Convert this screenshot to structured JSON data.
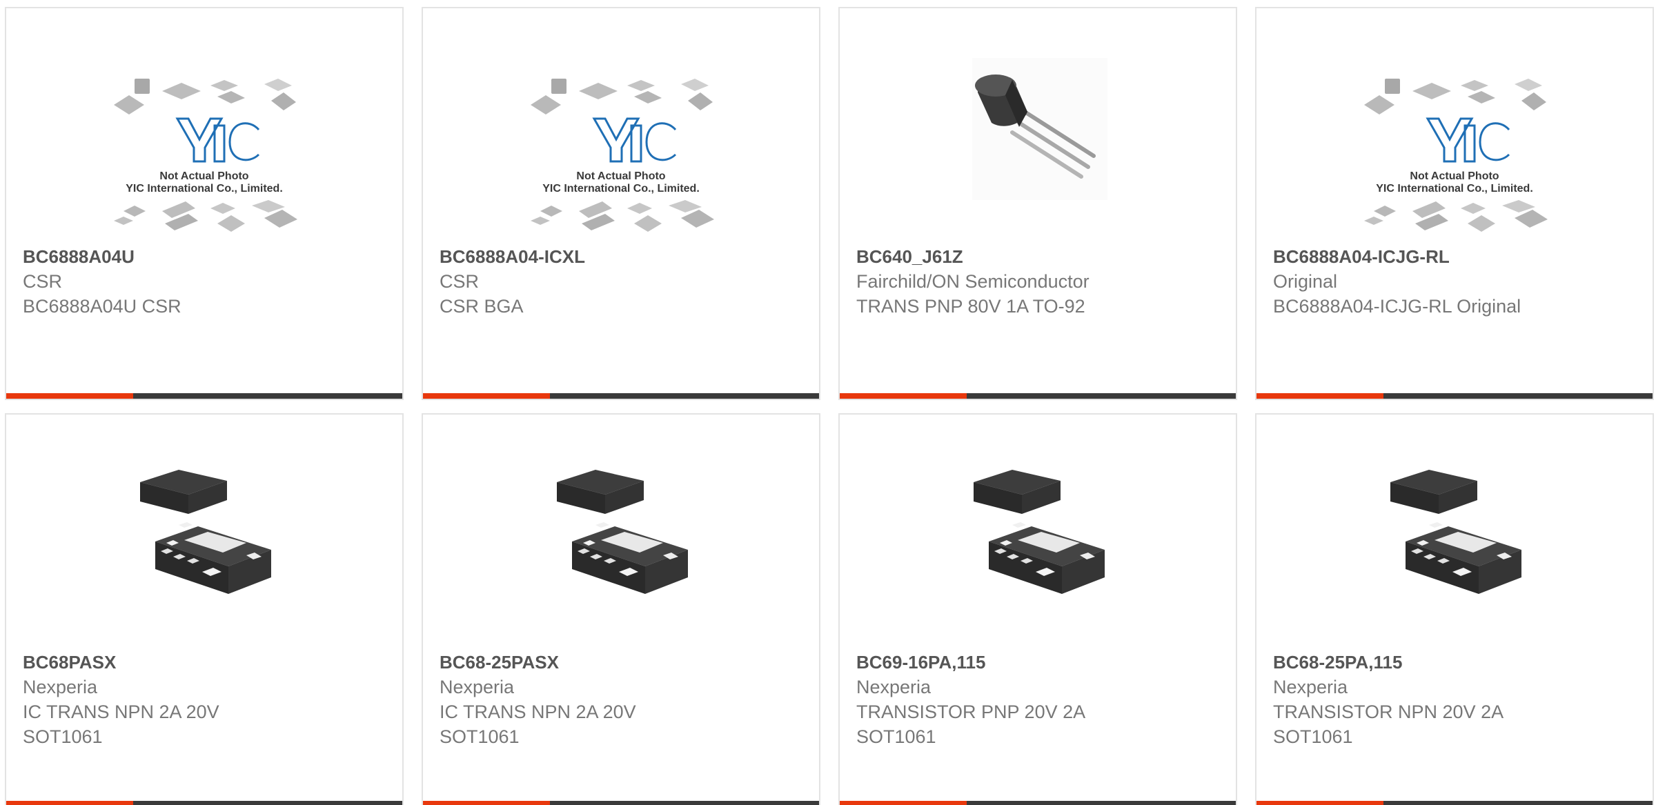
{
  "colors": {
    "accent": "#e8380d",
    "bar_dark": "#3a3a3a",
    "text_title": "#555555",
    "text_body": "#777777",
    "card_border": "#e3e3e3"
  },
  "products": [
    {
      "part": "BC6888A04U",
      "lines": [
        "CSR",
        "BC6888A04U CSR"
      ],
      "image": "yic-placeholder",
      "placeholder_caption": [
        "Not Actual Photo",
        "YIC International Co., Limited."
      ]
    },
    {
      "part": "BC6888A04-ICXL",
      "lines": [
        "CSR",
        "CSR BGA"
      ],
      "image": "yic-placeholder",
      "placeholder_caption": [
        "Not Actual Photo",
        "YIC International Co., Limited."
      ]
    },
    {
      "part": "BC640_J61Z",
      "lines": [
        "Fairchild/ON Semiconductor",
        "TRANS PNP 80V 1A TO-92"
      ],
      "image": "to92-transistor"
    },
    {
      "part": "BC6888A04-ICJG-RL",
      "lines": [
        "Original",
        "BC6888A04-ICJG-RL Original"
      ],
      "image": "yic-placeholder",
      "placeholder_caption": [
        "Not Actual Photo",
        "YIC International Co., Limited."
      ]
    },
    {
      "part": "BC68PASX",
      "lines": [
        "Nexperia",
        "IC TRANS NPN 2A 20V",
        "SOT1061"
      ],
      "image": "sot1061-package"
    },
    {
      "part": "BC68-25PASX",
      "lines": [
        "Nexperia",
        "IC TRANS NPN 2A 20V",
        "SOT1061"
      ],
      "image": "sot1061-package"
    },
    {
      "part": "BC69-16PA,115",
      "lines": [
        "Nexperia",
        "TRANSISTOR PNP 20V 2A",
        "SOT1061"
      ],
      "image": "sot1061-package"
    },
    {
      "part": "BC68-25PA,115",
      "lines": [
        "Nexperia",
        "TRANSISTOR NPN 20V 2A",
        "SOT1061"
      ],
      "image": "sot1061-package"
    }
  ]
}
